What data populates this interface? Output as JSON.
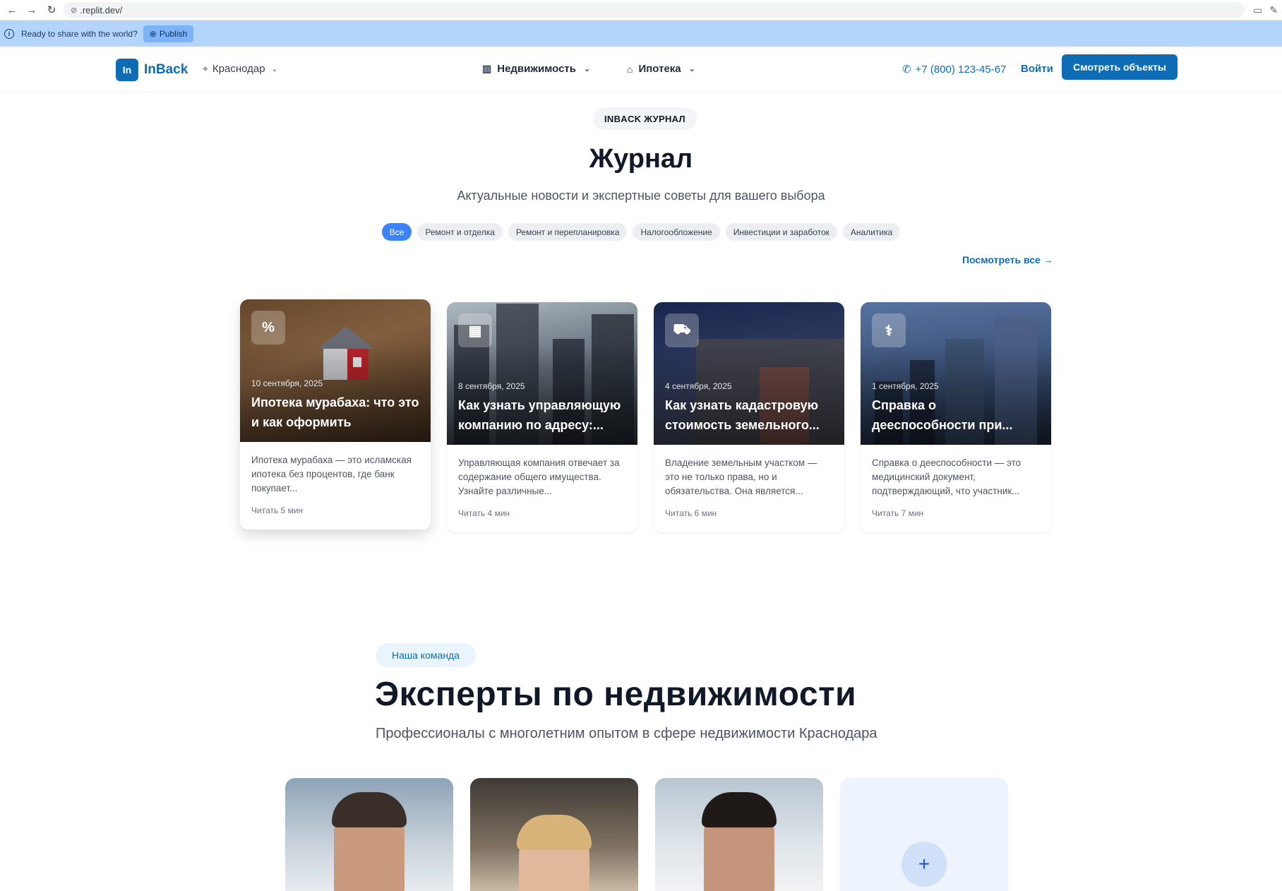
{
  "browser": {
    "url": ".replit.dev/"
  },
  "publish_bar": {
    "message": "Ready to share with the world?",
    "button": "Publish"
  },
  "header": {
    "logo_mark": "In",
    "logo_text": "InBack",
    "city": "Краснодар",
    "menu": [
      {
        "label": "Недвижимость",
        "icon": "building-icon"
      },
      {
        "label": "Ипотека",
        "icon": "home-icon"
      }
    ],
    "phone": "+7 (800) 123-45-67",
    "login": "Войти",
    "cta": "Смотреть объекты"
  },
  "journal": {
    "badge": "INBACK ЖУРНАЛ",
    "title": "Журнал",
    "subtitle": "Актуальные новости и экспертные советы для вашего выбора",
    "filters": [
      "Все",
      "Ремонт и отделка",
      "Ремонт и перепланировка",
      "Налогообложение",
      "Инвестиции и заработок",
      "Аналитика"
    ],
    "active_filter": "Все",
    "view_all": "Посмотреть все →",
    "articles": [
      {
        "icon": "percent-icon",
        "icon_glyph": "%",
        "date": "10 сентября, 2025",
        "title": "Ипотека мурабаха: что это и как оформить",
        "excerpt": "Ипотека мурабаха — это исламская ипотека без процентов, где банк покупает...",
        "read": "Читать 5 мин"
      },
      {
        "icon": "building-icon",
        "icon_glyph": "▦",
        "date": "8 сентября, 2025",
        "title": "Как узнать управляющую компанию по адресу:...",
        "excerpt": "Управляющая компания отвечает за содержание общего имущества. Узнайте различные...",
        "read": "Читать 4 мин"
      },
      {
        "icon": "tractor-icon",
        "icon_glyph": "⛟",
        "date": "4 сентября, 2025",
        "title": "Как узнать кадастровую стоимость земельного...",
        "excerpt": "Владение земельным участком — это не только права, но и обязательства. Она является...",
        "read": "Читать 6 мин"
      },
      {
        "icon": "stethoscope-icon",
        "icon_glyph": "⚕",
        "date": "1 сентября, 2025",
        "title": "Справка о дееспособности при...",
        "excerpt": "Справка о дееспособности — это медицинский документ, подтверждающий, что участник...",
        "read": "Читать 7 мин"
      }
    ]
  },
  "team": {
    "badge": "Наша команда",
    "title": "Эксперты по недвижимости",
    "subtitle": "Профессионалы с многолетним опытом в сфере недвижимости Краснодара",
    "add_icon": "plus-icon"
  },
  "colors": {
    "brand": "#0e6cb5",
    "active_filter": "#3b82f6"
  }
}
